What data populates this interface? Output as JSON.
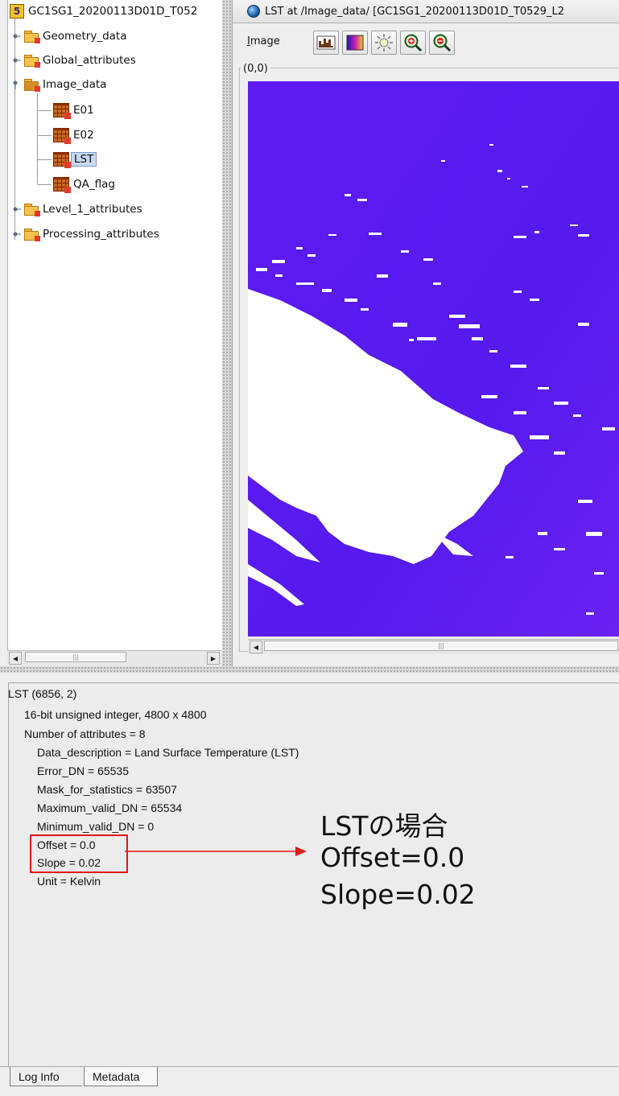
{
  "tree": {
    "root": "GC1SG1_20200113D01D_T052",
    "nodes": {
      "geometry": "Geometry_data",
      "global": "Global_attributes",
      "image_data": "Image_data",
      "e01": "E01",
      "e02": "E02",
      "lst": "LST",
      "qa": "QA_flag",
      "level1": "Level_1_attributes",
      "processing": "Processing_attributes"
    }
  },
  "viewer": {
    "title": "LST  at  /Image_data/  [GC1SG1_20200113D01D_T0529_L2",
    "menu_label": "Image",
    "coord_label": "(0,0)",
    "tool_icons": [
      "histogram-icon",
      "palette-icon",
      "brightness-icon",
      "zoom-in-icon",
      "zoom-out-icon"
    ],
    "colors": {
      "image": "#5a18f0",
      "cloud": "#ffffff"
    }
  },
  "metadata": {
    "header": "LST (6856, 2)",
    "type_line": "16-bit unsigned integer,    4800 x 4800",
    "attr_count": "Number of attributes = 8",
    "attrs": [
      "Data_description = Land Surface Temperature (LST)",
      "Error_DN = 65535",
      "Mask_for_statistics = 63507",
      "Maximum_valid_DN = 65534",
      "Minimum_valid_DN = 0",
      "Offset = 0.0",
      "Slope = 0.02",
      "Unit = Kelvin"
    ]
  },
  "annotation": {
    "line1": "LSTの場合",
    "line2": "Offset=0.0",
    "line3": "Slope=0.02",
    "color": "#e01818"
  },
  "tabs": [
    "Log Info",
    "Metadata"
  ]
}
